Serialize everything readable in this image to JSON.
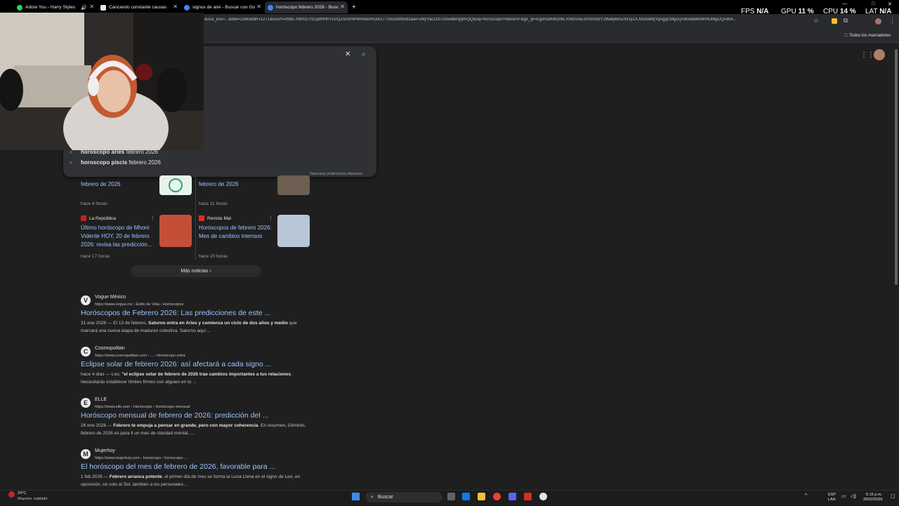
{
  "tabs": [
    {
      "title": "Adore You - Harry Styles",
      "color": "#1ed760",
      "active": false
    },
    {
      "title": "Cancando constante causas",
      "color": "#e8eaed",
      "active": false
    },
    {
      "title": "signos de aire - Buscar con Go",
      "color": "#4285f4",
      "active": false
    },
    {
      "title": "horóscopo febrero 2026 - Busc",
      "color": "#4285f4",
      "active": true
    }
  ],
  "overlay": {
    "fps_label": "FPS",
    "fps_value": "N/A",
    "gpu_label": "GPU",
    "gpu_value": "11 %",
    "cpu_label": "CPU",
    "cpu_value": "14 %",
    "lat_label": "LAT",
    "lat_value": "N/A"
  },
  "address_bar": {
    "url": "&sca_esv=...&biw=2560&bih=1271&sxsrf=ANbL-nWXD7f1DpfHHhYsUQZIoSrRP4RmwA%3A1771625608582&ei=uNyYac2OI-OGwbkPjqfmQQ&oq=horoscopo+febrero+&gs_lp=Egxnd3Mtd2l6LXNlcnAiE2hvcm9zY29wbyBmZWJyZXJvIDIwMjYqAggCMgoQABiABBiKBRhDMgUQABiA..."
  },
  "bookmarks": {
    "all_label": "Todos los marcadores"
  },
  "search_dropdown": {
    "suggestions": [
      {
        "bold": "horoscopo aries",
        "rest": " febrero 2026"
      },
      {
        "bold": "horoscopo piscis",
        "rest": " febrero 2026"
      }
    ],
    "remove_label": "Denunciar predicciones ofensivas"
  },
  "news": {
    "cards": [
      {
        "title": "febrero de 2026",
        "meta": "hace 4 horas"
      },
      {
        "title": "febrero de 2026",
        "meta": "hace 11 horas"
      },
      {
        "source": "La República",
        "title": "Último horóscopo de Mhoni Vidente HOY, 20 de febrero 2026: revisa las predicción...",
        "meta": "hace 17 horas"
      },
      {
        "source": "Revista Mal",
        "title": "Horóscopos de febrero 2026: Mes de cambios intensos",
        "meta": "hace 20 horas"
      }
    ],
    "more_label": "Más noticias"
  },
  "results": [
    {
      "letter": "V",
      "site": "Vogue México",
      "url": "https://www.vogue.mx › Estilo de Vida › Horóscopos",
      "title": "Horóscopos de Febrero 2026: Las predicciones de este ...",
      "date": "31 ene 2026 — El 13 de febrero, ",
      "bold": "Saturno entra en Aries y comienza un ciclo de dos años y medio",
      "rest": " que marcará una nueva etapa de madurez colectiva. Saturno aquí ..."
    },
    {
      "letter": "C",
      "site": "Cosmopolitan",
      "url": "https://www.cosmopolitan.com › ... › Horóscopo extra",
      "title": "Eclipse solar de febrero 2026: así afectará a cada signo ...",
      "date": "hace 4 días — Leo, ",
      "bold": "\"el eclipse solar de febrero de 2026 trae cambios importantes a tus relaciones",
      "rest": ". Necesitarás establecer límites firmes con alguien en tu ..."
    },
    {
      "letter": "E",
      "site": "ELLE",
      "url": "https://www.elle.com › Horóscopo › Horóscopo mensual",
      "title": "Horóscopo mensual de febrero de 2026: predicción del ...",
      "date": "26 ene 2026 — ",
      "bold": "Febrero te empuja a pensar en grande, pero con mayor coherencia",
      "rest": ". En resumen, Géminis, febrero de 2026 es para ti un mes de claridad mental, ..."
    },
    {
      "letter": "M",
      "site": "Mujerhoy",
      "url": "https://www.mujerhoy.com › horoscopo › horoscopo-...",
      "title": "El horóscopo del mes de febrero de 2026, favorable para ...",
      "date": "1 feb 2026 — ",
      "bold": "Febrero arranca potente",
      "rest": ", el primer día de mes se forma la Luna Llena en el signo de Leo, en oposición, no solo al Sol, también a los personales ..."
    }
  ],
  "taskbar": {
    "weather_temp": "24°C",
    "weather_desc": "Mayorm. nublado",
    "search_label": "Buscar",
    "lang_top": "ESP",
    "lang_bottom": "LAA",
    "time": "5:15 p.m.",
    "date": "20/02/2026"
  }
}
